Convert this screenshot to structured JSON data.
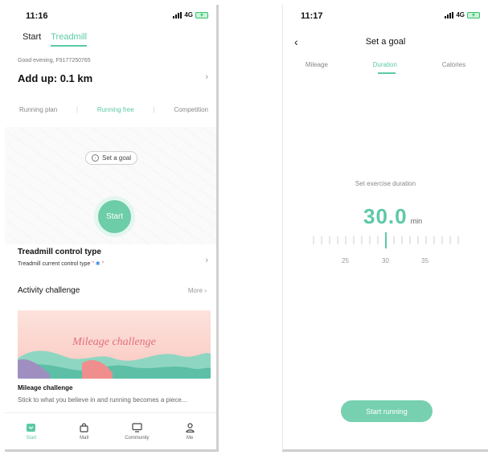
{
  "left": {
    "status": {
      "time": "11:16",
      "network": "4G"
    },
    "top_tabs": [
      "Start",
      "Treadmill"
    ],
    "greeting": "Good evening, F9177250765",
    "addup": "Add up: 0.1 km",
    "mode_tabs": [
      "Running plan",
      "Running free",
      "Competition"
    ],
    "set_goal": "Set a goal",
    "start": "Start",
    "control": {
      "title": "Treadmill control type",
      "subtitle_prefix": "Treadmill current control type",
      "quote_open": "\"",
      "quote_close": "\""
    },
    "activity": {
      "title": "Activity challenge",
      "more": "More"
    },
    "banner_text": "Mileage challenge",
    "challenge": {
      "title": "Mileage challenge",
      "desc": "Stick to what you believe in and running becomes a piece..."
    },
    "tabbar": [
      {
        "label": "Start",
        "icon": "start-icon"
      },
      {
        "label": "Mall",
        "icon": "bag-icon"
      },
      {
        "label": "Community",
        "icon": "monitor-icon"
      },
      {
        "label": "Me",
        "icon": "person-icon"
      }
    ]
  },
  "right": {
    "status": {
      "time": "11:17",
      "network": "4G"
    },
    "nav_title": "Set a goal",
    "goal_tabs": [
      "Mileage",
      "Duration",
      "Calories"
    ],
    "set_label": "Set exercise duration",
    "duration": {
      "value": "30.0",
      "unit": "min"
    },
    "ruler_labels": [
      "25",
      "30",
      "35"
    ],
    "button": "Start running"
  },
  "colors": {
    "accent": "#5cc9a7",
    "button": "#77d0b0",
    "banner_text": "#e0707a"
  }
}
